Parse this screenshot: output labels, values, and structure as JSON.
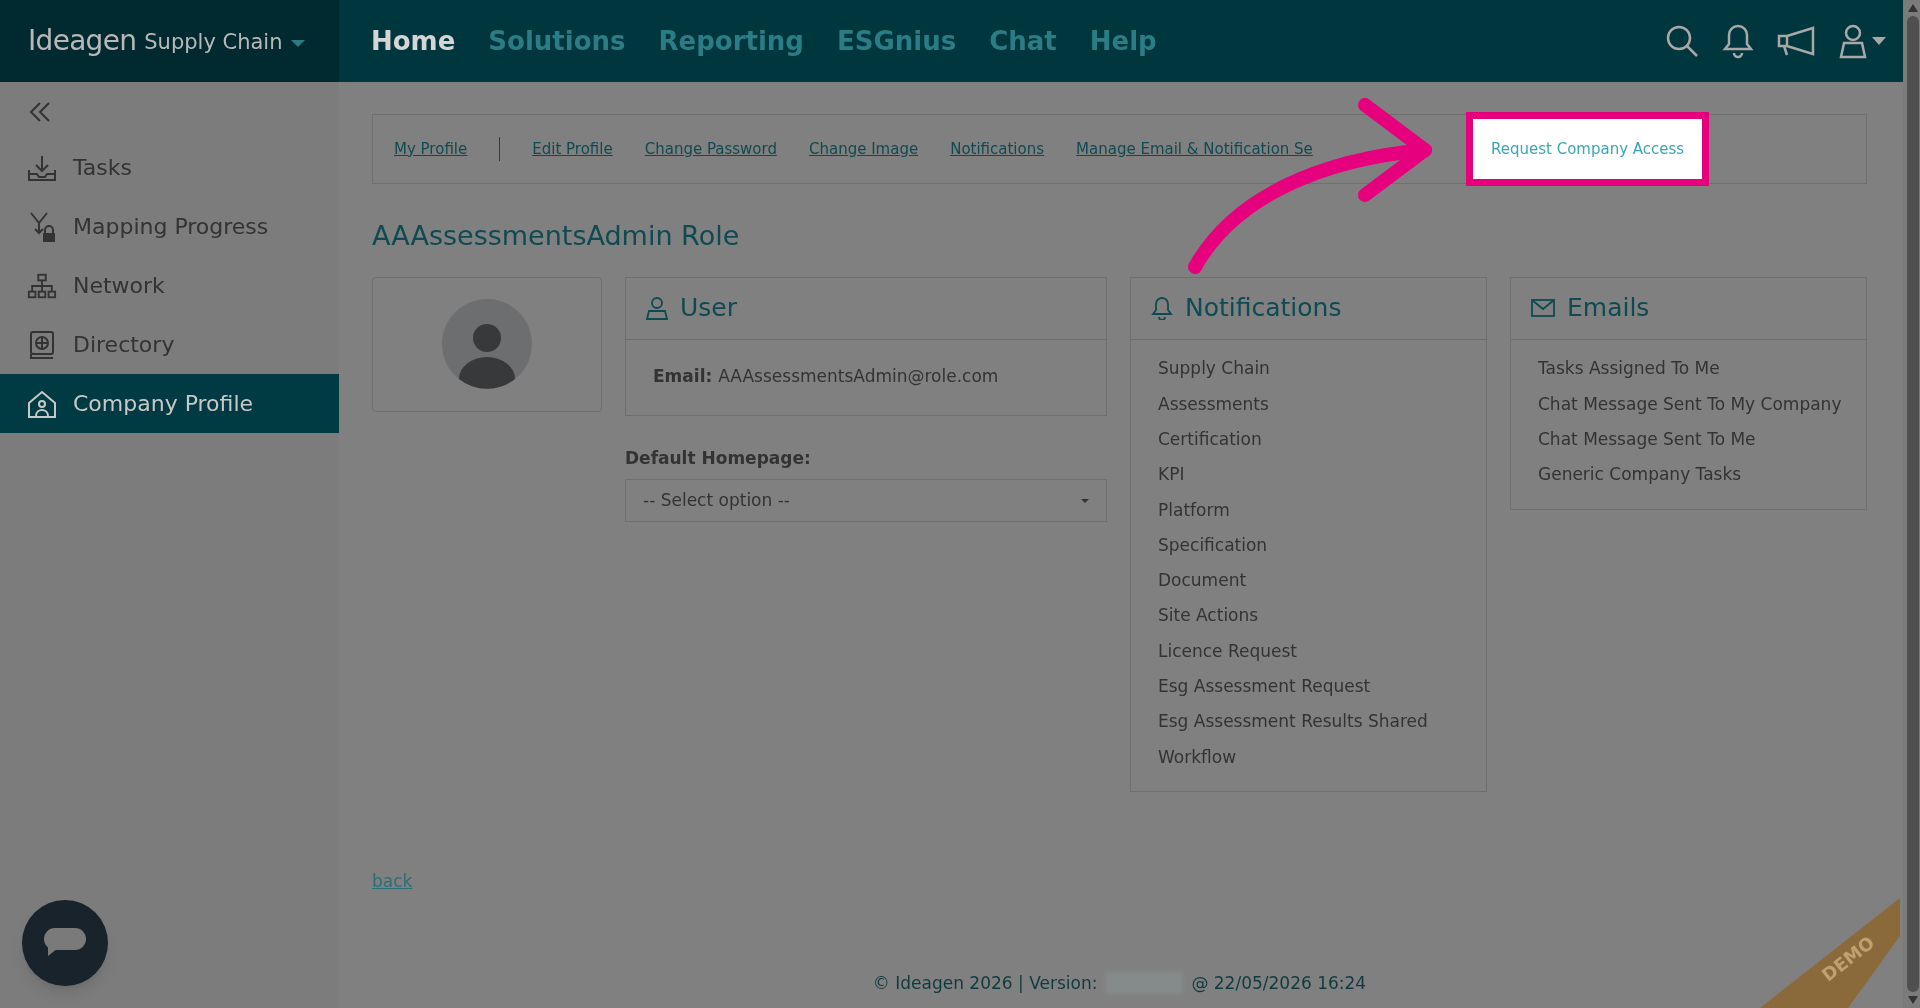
{
  "brand": {
    "logo": "Ideagen",
    "product": "Supply Chain"
  },
  "nav": [
    {
      "label": "Home",
      "selected": true
    },
    {
      "label": "Solutions",
      "selected": false
    },
    {
      "label": "Reporting",
      "selected": false
    },
    {
      "label": "ESGnius",
      "selected": false
    },
    {
      "label": "Chat",
      "selected": false
    },
    {
      "label": "Help",
      "selected": false
    }
  ],
  "sidebar": {
    "items": [
      {
        "label": "Tasks",
        "selected": false
      },
      {
        "label": "Mapping Progress",
        "selected": false
      },
      {
        "label": "Network",
        "selected": false
      },
      {
        "label": "Directory",
        "selected": false
      },
      {
        "label": "Company Profile",
        "selected": true
      }
    ]
  },
  "tabs": [
    {
      "label": "My Profile",
      "highlighted": false
    },
    {
      "label": "Edit Profile",
      "highlighted": false
    },
    {
      "label": "Change Password",
      "highlighted": false
    },
    {
      "label": "Change Image",
      "highlighted": false
    },
    {
      "label": "Notifications",
      "highlighted": false
    },
    {
      "label": "Manage Email & Notification Se",
      "highlighted": false
    },
    {
      "label": "Request Company Access",
      "highlighted": true
    }
  ],
  "title": "AAAssessmentsAdmin Role",
  "user_card": {
    "title": "User",
    "email_label": "Email:",
    "email": "AAAssessmentsAdmin@role.com"
  },
  "default_homepage": {
    "label": "Default Homepage:",
    "value": "-- Select option --"
  },
  "notifications": {
    "title": "Notifications",
    "items": [
      "Supply Chain",
      "Assessments",
      "Certification",
      "KPI",
      "Platform",
      "Specification",
      "Document",
      "Site Actions",
      "Licence Request",
      "Esg Assessment Request",
      "Esg Assessment Results Shared",
      "Workflow"
    ]
  },
  "emails": {
    "title": "Emails",
    "items": [
      "Tasks Assigned To Me",
      "Chat Message Sent To My Company",
      "Chat Message Sent To Me",
      "Generic Company Tasks"
    ]
  },
  "back_link": "back",
  "footer": {
    "left": "© Ideagen 2026 | Version:",
    "right": "@ 22/05/2026 16:24"
  },
  "ribbon": "DEMO"
}
